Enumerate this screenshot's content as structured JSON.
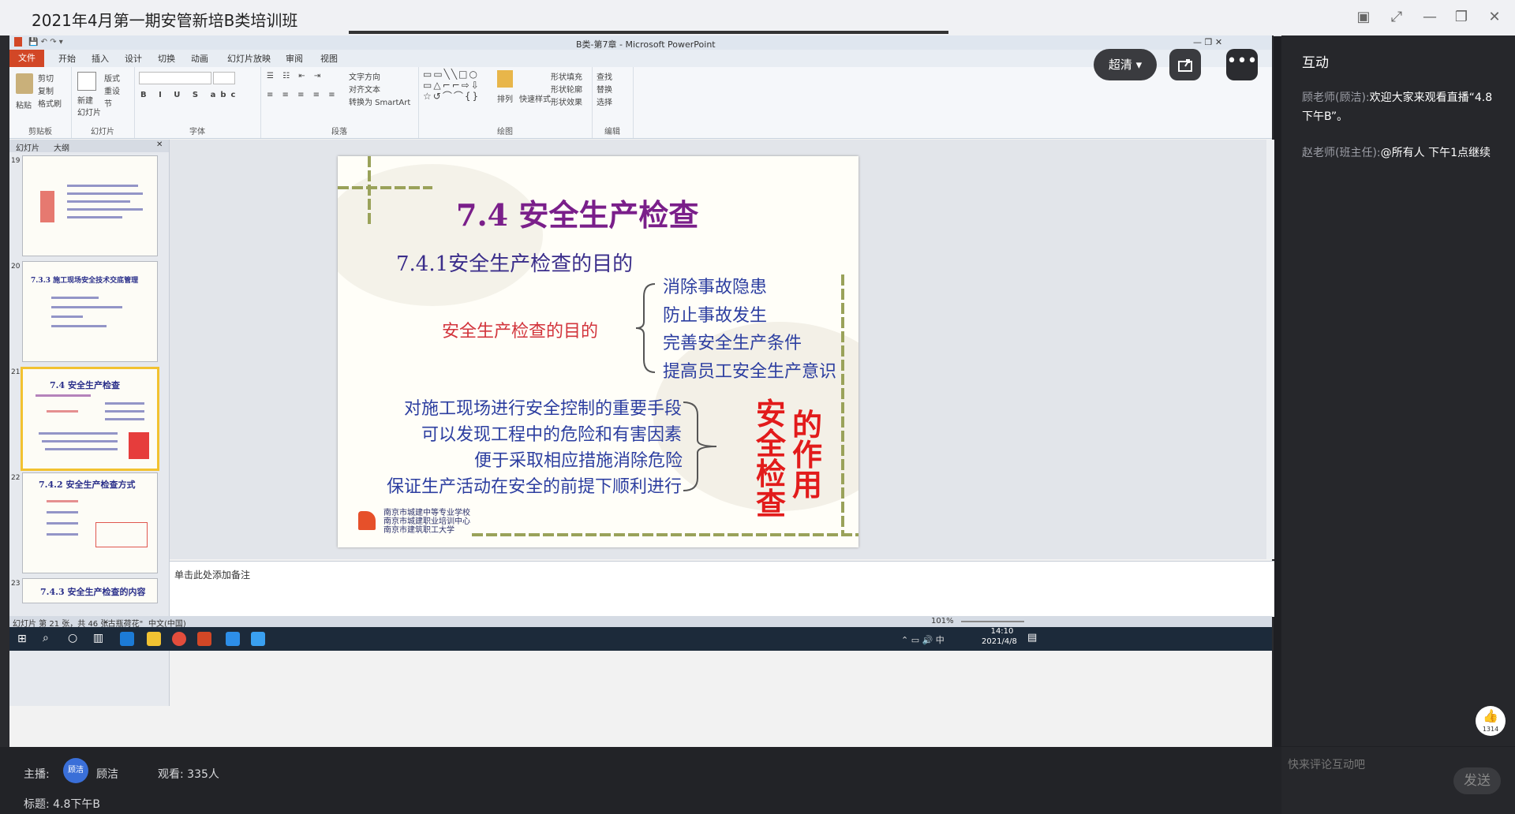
{
  "window": {
    "title": "2021年4月第一期安管新培B类培训班"
  },
  "ppt": {
    "window_title": "B类-第7章 - Microsoft PowerPoint",
    "tabs": [
      "文件",
      "开始",
      "插入",
      "设计",
      "切换",
      "动画",
      "幻灯片放映",
      "审阅",
      "视图"
    ],
    "ribbon_groups": [
      "剪贴板",
      "幻灯片",
      "字体",
      "段落",
      "绘图",
      "编辑"
    ],
    "ribbon_items": {
      "paste": "粘贴",
      "cut": "剪切",
      "copy": "复制",
      "format_painter": "格式刷",
      "new_slide": "新建\n幻灯片",
      "layout": "版式",
      "reset": "重设",
      "section": "节",
      "text_dir": "文字方向",
      "align_text": "对齐文本",
      "smartart": "转换为 SmartArt",
      "arrange": "排列",
      "quick_styles": "快速样式",
      "shape_fill": "形状填充",
      "shape_outline": "形状轮廓",
      "shape_effects": "形状效果",
      "find": "查找",
      "replace": "替换",
      "select": "选择"
    },
    "panel_tabs": [
      "幻灯片",
      "大纲"
    ],
    "thumbs": [
      {
        "num": "19",
        "title": ""
      },
      {
        "num": "20",
        "title": "7.3.3 施工现场安全技术交底管理"
      },
      {
        "num": "21",
        "title": "7.4  安全生产检查"
      },
      {
        "num": "22",
        "title": "7.4.2 安全生产检查方式"
      },
      {
        "num": "23",
        "title": "7.4.3  安全生产检查的内容"
      }
    ],
    "slide": {
      "title": "7.4   安全生产检查",
      "subtitle": "7.4.1安全生产检查的目的",
      "purpose_label": "安全生产检查的目的",
      "purposes": [
        "消除事故隐患",
        "防止事故发生",
        "完善安全生产条件",
        "提高员工安全生产意识"
      ],
      "roles": [
        "对施工现场进行安全控制的重要手段",
        "可以发现工程中的危险和有害因素",
        "便于采取相应措施消除危险",
        "保证生产活动在安全的前提下顺利进行"
      ],
      "role_big_1": "安全检查",
      "role_big_2": "的作用",
      "school_lines": [
        "南京市城建中等专业学校",
        "南京市城建职业培训中心",
        "南京市建筑职工大学"
      ]
    },
    "notes_placeholder": "单击此处添加备注",
    "status": {
      "slide_info": "幻灯片 第 21 张，共 46 张",
      "theme": "\"古瓶荷花\"",
      "lang": "中文(中国)",
      "zoom": "101%"
    },
    "clock": {
      "time": "14:10",
      "date": "2021/4/8"
    }
  },
  "player": {
    "quality": "超清"
  },
  "sidebar": {
    "title": "互动",
    "messages": [
      {
        "user": "顾老师(顾洁):",
        "text": "欢迎大家来观看直播“4.8下午B”。"
      },
      {
        "user": "赵老师(班主任):",
        "text": "@所有人 下午1点继续"
      }
    ],
    "like_count": "1314",
    "comment_placeholder": "快来评论互动吧",
    "send_label": "发送"
  },
  "bottom": {
    "host_label": "主播:",
    "host_avatar": "顾洁",
    "host_name": "顾洁",
    "viewers": "观看: 335人",
    "topic": "标题: 4.8下午B"
  }
}
